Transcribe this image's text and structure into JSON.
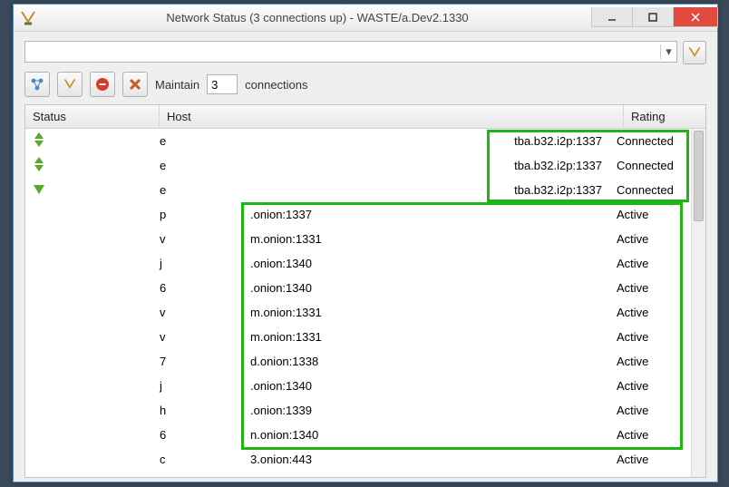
{
  "window": {
    "title": "Network Status (3 connections up) - WASTE/a.Dev2.1330"
  },
  "toolbar": {
    "address_value": "",
    "maintain_label": "Maintain",
    "maintain_value": "3",
    "connections_label": "connections"
  },
  "columns": {
    "status": "Status",
    "host": "Host",
    "rating": "Rating"
  },
  "rows": [
    {
      "icon": "updown",
      "host_pre": "e",
      "host_mid": "",
      "host_right": "tba.b32.i2p:1337",
      "rating": "Connected"
    },
    {
      "icon": "updown",
      "host_pre": "e",
      "host_mid": "",
      "host_right": "tba.b32.i2p:1337",
      "rating": "Connected"
    },
    {
      "icon": "down",
      "host_pre": "e",
      "host_mid": "",
      "host_right": "tba.b32.i2p:1337",
      "rating": "Connected"
    },
    {
      "icon": "",
      "host_pre": "p",
      "host_mid": ".onion:1337",
      "host_right": "",
      "rating": "Active"
    },
    {
      "icon": "",
      "host_pre": "v",
      "host_mid": "m.onion:1331",
      "host_right": "",
      "rating": "Active"
    },
    {
      "icon": "",
      "host_pre": "j",
      "host_mid": ".onion:1340",
      "host_right": "",
      "rating": "Active"
    },
    {
      "icon": "",
      "host_pre": "6",
      "host_mid": ".onion:1340",
      "host_right": "",
      "rating": "Active"
    },
    {
      "icon": "",
      "host_pre": "v",
      "host_mid": "m.onion:1331",
      "host_right": "",
      "rating": "Active"
    },
    {
      "icon": "",
      "host_pre": "v",
      "host_mid": "m.onion:1331",
      "host_right": "",
      "rating": "Active"
    },
    {
      "icon": "",
      "host_pre": "7",
      "host_mid": "d.onion:1338",
      "host_right": "",
      "rating": "Active"
    },
    {
      "icon": "",
      "host_pre": "j",
      "host_mid": ".onion:1340",
      "host_right": "",
      "rating": "Active"
    },
    {
      "icon": "",
      "host_pre": "h",
      "host_mid": ".onion:1339",
      "host_right": "",
      "rating": "Active"
    },
    {
      "icon": "",
      "host_pre": "6",
      "host_mid": "n.onion:1340",
      "host_right": "",
      "rating": "Active"
    },
    {
      "icon": "",
      "host_pre": "c",
      "host_mid": "3.onion:443",
      "host_right": "",
      "rating": "Active"
    }
  ],
  "icons": {
    "app": "waste-icon",
    "add_node": "network-nodes-icon",
    "refresh": "lightning-icon",
    "stop": "stop-circle-icon",
    "delete": "delete-x-icon"
  }
}
